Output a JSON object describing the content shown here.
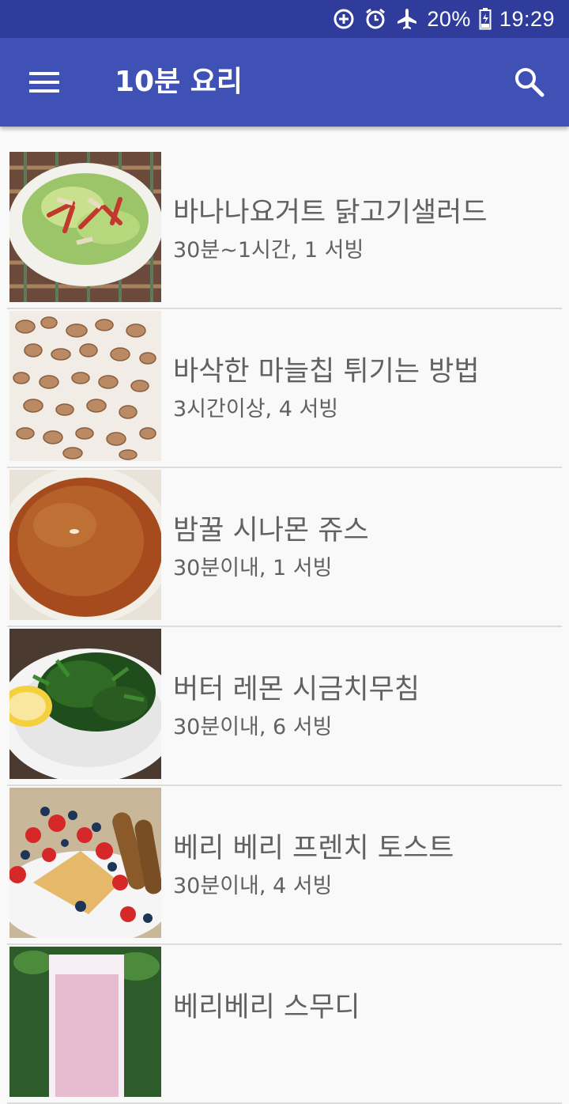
{
  "status_bar": {
    "battery": "20%",
    "time": "19:29"
  },
  "app_bar": {
    "title": "10분 요리",
    "menu_icon": "hamburger-menu-icon",
    "search_icon": "search-icon"
  },
  "recipes": [
    {
      "title": "바나나요거트 닭고기샐러드",
      "meta": "30분~1시간, 1 서빙"
    },
    {
      "title": "바삭한 마늘칩 튀기는 방법",
      "meta": "3시간이상, 4 서빙"
    },
    {
      "title": "밤꿀 시나몬 쥬스",
      "meta": "30분이내, 1 서빙"
    },
    {
      "title": "버터 레몬 시금치무침",
      "meta": "30분이내, 6 서빙"
    },
    {
      "title": "베리 베리 프렌치 토스트",
      "meta": "30분이내, 4 서빙"
    },
    {
      "title": "베리베리 스무디",
      "meta": ""
    }
  ],
  "colors": {
    "status_bar": "#2f3c9c",
    "app_bar": "#3f51b5",
    "background": "#f9f9f9",
    "text": "#616161"
  }
}
